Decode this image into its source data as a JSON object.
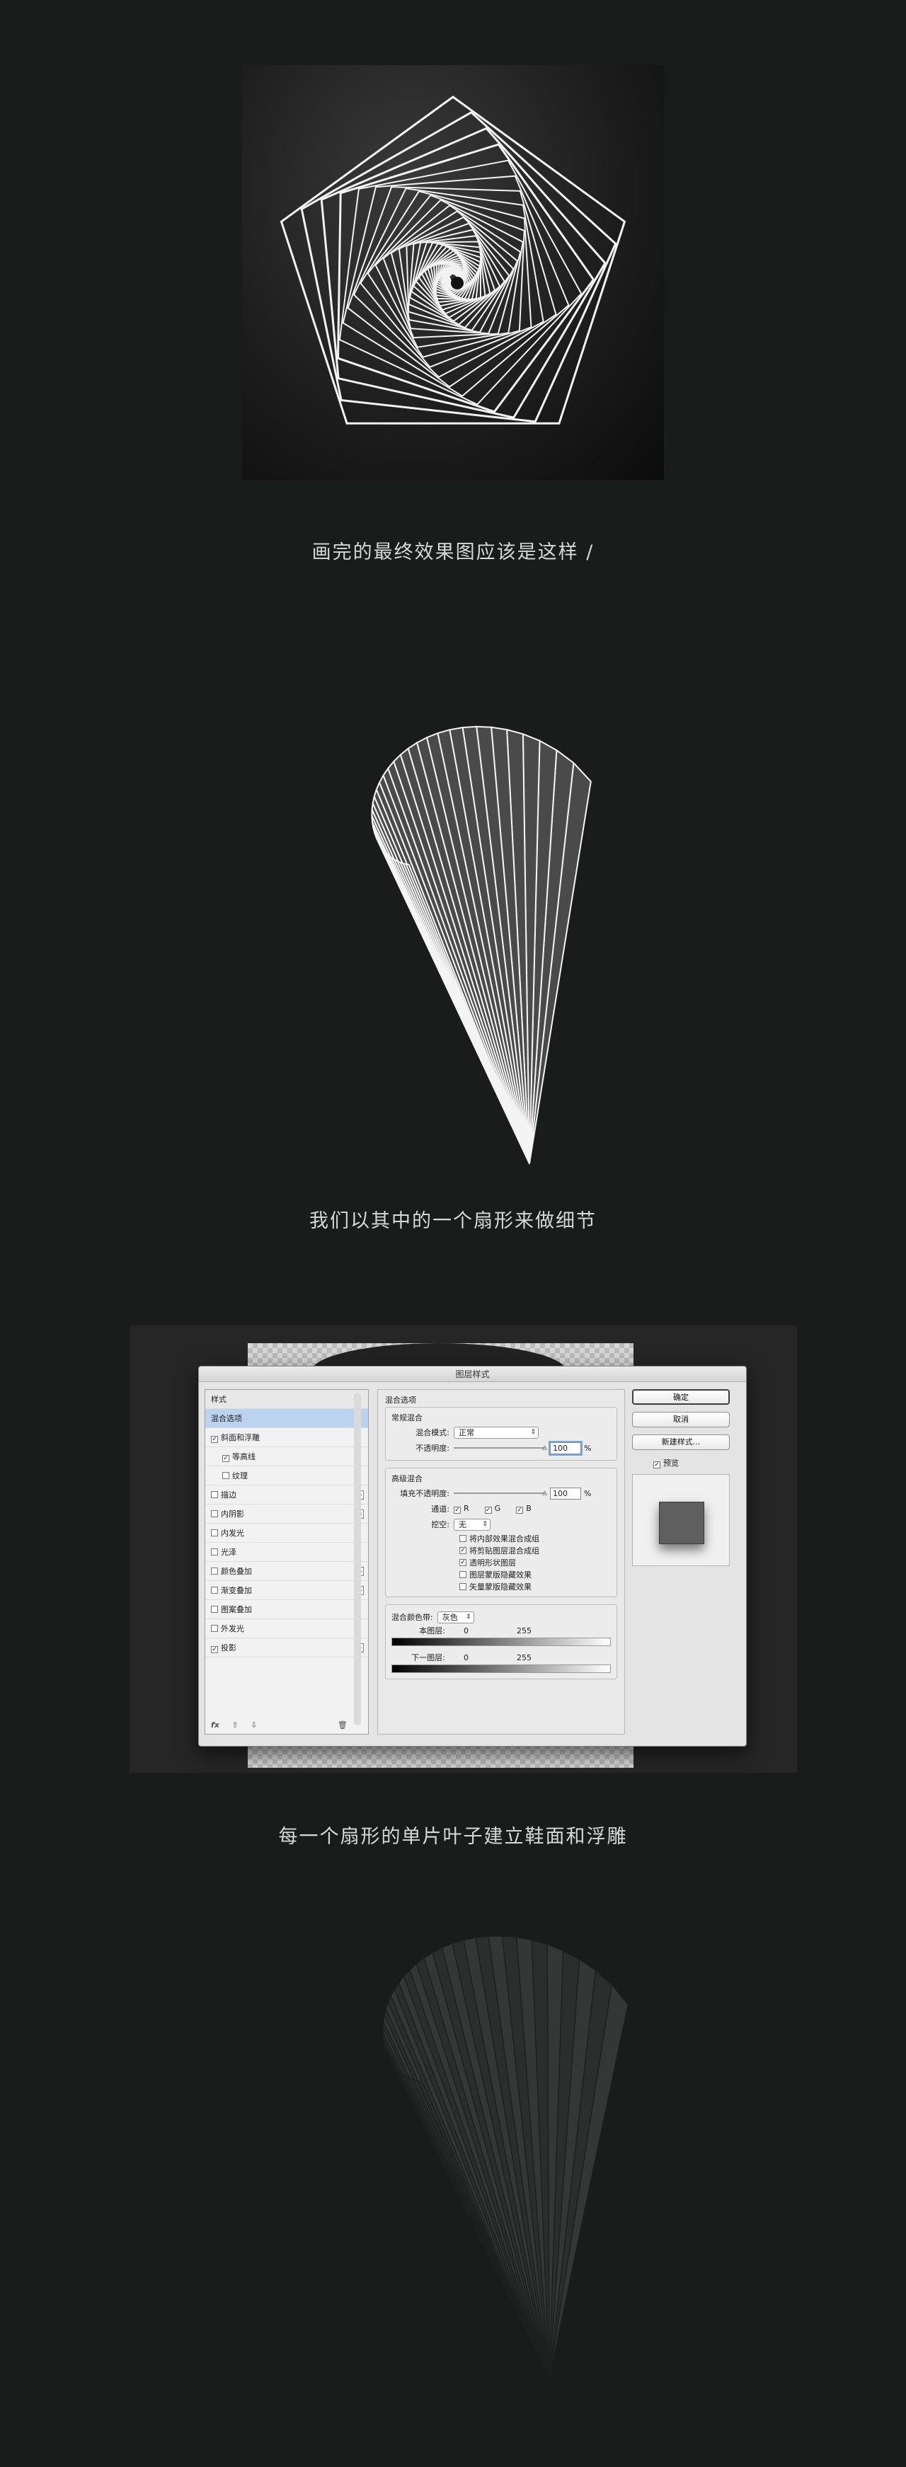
{
  "captions": {
    "final_effect": "画完的最终效果图应该是这样 /",
    "detail_fan": "我们以其中的一个扇形来做细节",
    "bevel_emboss": "每一个扇形的单片叶子建立鞋面和浮雕"
  },
  "dialog": {
    "title": "图层样式",
    "styles_header": "样式",
    "style_items": [
      {
        "label": "混合选项",
        "checked": false,
        "has_checkbox": false,
        "has_plus": false,
        "selected": true,
        "sub": false
      },
      {
        "label": "斜面和浮雕",
        "checked": true,
        "has_checkbox": true,
        "has_plus": false,
        "selected": false,
        "sub": false
      },
      {
        "label": "等高线",
        "checked": true,
        "has_checkbox": true,
        "has_plus": false,
        "selected": false,
        "sub": true
      },
      {
        "label": "纹理",
        "checked": false,
        "has_checkbox": true,
        "has_plus": false,
        "selected": false,
        "sub": true
      },
      {
        "label": "描边",
        "checked": false,
        "has_checkbox": true,
        "has_plus": true,
        "selected": false,
        "sub": false
      },
      {
        "label": "内阴影",
        "checked": false,
        "has_checkbox": true,
        "has_plus": true,
        "selected": false,
        "sub": false
      },
      {
        "label": "内发光",
        "checked": false,
        "has_checkbox": true,
        "has_plus": false,
        "selected": false,
        "sub": false
      },
      {
        "label": "光泽",
        "checked": false,
        "has_checkbox": true,
        "has_plus": false,
        "selected": false,
        "sub": false
      },
      {
        "label": "颜色叠加",
        "checked": false,
        "has_checkbox": true,
        "has_plus": true,
        "selected": false,
        "sub": false
      },
      {
        "label": "渐变叠加",
        "checked": false,
        "has_checkbox": true,
        "has_plus": true,
        "selected": false,
        "sub": false
      },
      {
        "label": "图案叠加",
        "checked": false,
        "has_checkbox": true,
        "has_plus": false,
        "selected": false,
        "sub": false
      },
      {
        "label": "外发光",
        "checked": false,
        "has_checkbox": true,
        "has_plus": false,
        "selected": false,
        "sub": false
      },
      {
        "label": "投影",
        "checked": true,
        "has_checkbox": true,
        "has_plus": true,
        "selected": false,
        "sub": false
      }
    ],
    "fx_label": "fx",
    "blend_options_title": "混合选项",
    "general_blending": {
      "title": "常规混合",
      "mode_label": "混合模式:",
      "mode_value": "正常",
      "opacity_label": "不透明度:",
      "opacity_value": "100",
      "unit": "%"
    },
    "advanced_blending": {
      "title": "高级混合",
      "fill_opacity_label": "填充不透明度:",
      "fill_opacity_value": "100",
      "unit": "%",
      "channels_label": "通道:",
      "channels": [
        {
          "label": "R",
          "checked": true
        },
        {
          "label": "G",
          "checked": true
        },
        {
          "label": "B",
          "checked": true
        }
      ],
      "knockout_label": "挖空:",
      "knockout_value": "无",
      "options": [
        {
          "label": "将内部效果混合成组",
          "checked": false
        },
        {
          "label": "将剪贴图层混合成组",
          "checked": true
        },
        {
          "label": "透明形状图层",
          "checked": true
        },
        {
          "label": "图层蒙版隐藏效果",
          "checked": false
        },
        {
          "label": "矢量蒙版隐藏效果",
          "checked": false
        }
      ]
    },
    "blend_if": {
      "label": "混合颜色带:",
      "value": "灰色",
      "this_layer_label": "本图层:",
      "this_layer_min": "0",
      "this_layer_max": "255",
      "under_layer_label": "下一图层:",
      "under_layer_min": "0",
      "under_layer_max": "255"
    },
    "buttons": {
      "ok": "确定",
      "cancel": "取消",
      "new_style": "新建样式..."
    },
    "preview_label": "预览",
    "preview_checked": true,
    "colors": {
      "swatch": "#5f5f5f",
      "selection": "#bcd3f0"
    }
  }
}
